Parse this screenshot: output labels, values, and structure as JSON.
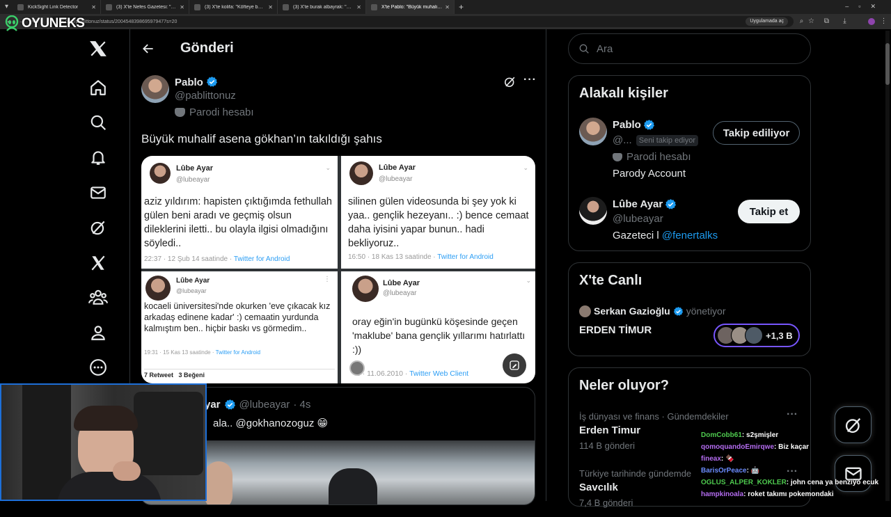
{
  "browser": {
    "tabs": [
      {
        "label": "KickSight Link Detector",
        "active": false
      },
      {
        "label": "(3) X'te Nefes Gazetesi: \"Sams...",
        "active": false
      },
      {
        "label": "(3) X'te kolifa: \"Köfteye bak köf...",
        "active": false
      },
      {
        "label": "(3) X'te burak albayrak: \"Abla s...",
        "active": false
      },
      {
        "label": "X'te Pablo: \"Büyük muhalif asen...",
        "active": true
      }
    ],
    "url": "x.com/pablittonuz/status/2004548398695979477s=20",
    "open_in_app": "Uygulamada aç",
    "new_tab": "+"
  },
  "overlay": {
    "logo": "OYUNEKS"
  },
  "header": {
    "title": "Gönderi"
  },
  "post": {
    "author_name": "Pablo",
    "author_handle": "@pablittonuz",
    "parody_label": "Parodi hesabı",
    "text": "Büyük muhalif asena gökhan’ın takıldığı şahıs",
    "screens": [
      {
        "name": "Lûbe Ayar",
        "handle": "@lubeayar",
        "text": "aziz yıldırım: hapisten çıktığımda fethullah gülen beni aradı ve geçmiş olsun dileklerini iletti.. bu olayla ilgisi olmadığını söyledi..",
        "time": "22:37 · 12 Şub 14 saatinde · ",
        "source": "Twitter for Android"
      },
      {
        "name": "Lûbe Ayar",
        "handle": "@lubeayar",
        "text": "silinen gülen videosunda bi şey yok ki yaa.. gençlik hezeyanı.. :) bence cemaat daha iyisini yapar bunun.. hadi bekliyoruz..",
        "time": "16:50 · 18 Kas 13 saatinde · ",
        "source": "Twitter for Android"
      },
      {
        "name": "Lûbe Ayar",
        "handle": "@lubeayar",
        "text": "kocaeli üniversitesi'nde okurken 'eve çıkacak kız arkadaş edinene kadar' :) cemaatin yurdunda kalmıştım ben.. hiçbir baskı vs görmedim..",
        "time": "19:31 · 15 Kas 13 saatinde · ",
        "source": "Twitter for Android",
        "retweets": "7 Retweet",
        "likes": "3 Beğeni"
      },
      {
        "name": "Lûbe Ayar",
        "handle": "@lubeayar",
        "text": "oray eğin'in bugünkü köşesinde geçen 'maklube' bana gençlik yıllarımı hatırlattı :))",
        "time": "3 · 11.06.2010 · ",
        "source": "Twitter Web Client"
      }
    ],
    "quoted": {
      "name_fragment": "yar",
      "handle": "@lubeayar",
      "time": "· 4s",
      "text_fragment": "ala.. @gokhanozoguz 😁"
    }
  },
  "search": {
    "placeholder": "Ara"
  },
  "related": {
    "title": "Alakalı kişiler",
    "people": [
      {
        "name": "Pablo",
        "handle": "@...",
        "follows_you": "Seni takip ediyor",
        "parody": "Parodi hesabı",
        "bio": "Parody Account",
        "button": "Takip ediliyor"
      },
      {
        "name": "Lûbe Ayar",
        "handle": "@lubeayar",
        "bio_prefix": "Gazeteci l ",
        "bio_link": "@fenertalks",
        "button": "Takip et"
      }
    ]
  },
  "live": {
    "title": "X'te Canlı",
    "host": "Serkan Gazioğlu",
    "host_role": "yönetiyor",
    "space_title": "ERDEN TİMUR",
    "listeners": "+1,3 B"
  },
  "trends": {
    "title": "Neler oluyor?",
    "items": [
      {
        "context": "İş dünyası ve finans · Gündemdekiler",
        "name": "Erden Timur",
        "count": "114 B gönderi"
      },
      {
        "context": "Türkiye tarihinde gündemde",
        "name": "Savcılık",
        "count": "7,4 B gönderi"
      }
    ]
  },
  "chat": [
    {
      "user": "DomCobb61",
      "color": "#4ec94e",
      "msg": ": s2şmişler"
    },
    {
      "user": "qomoquandoEmirqwe",
      "color": "#b46cf0",
      "msg": ": Biz kaçar"
    },
    {
      "user": "fineax",
      "color": "#b46cf0",
      "msg": ": 🍫"
    },
    {
      "user": "BarisOrPeace",
      "color": "#6b8cff",
      "msg": ": 🤖"
    },
    {
      "user": "OGLUS_ALPER_KOKLER",
      "color": "#4ec94e",
      "msg": ": john cena ya benziyo ecuk"
    },
    {
      "user": "hampkinoala",
      "color": "#b46cf0",
      "msg": ": roket takımı pokemondaki"
    }
  ],
  "colors": {
    "accent": "#1d9bf0",
    "border": "#2f3336",
    "muted": "#71767b",
    "live_ring": "#7856ff"
  }
}
